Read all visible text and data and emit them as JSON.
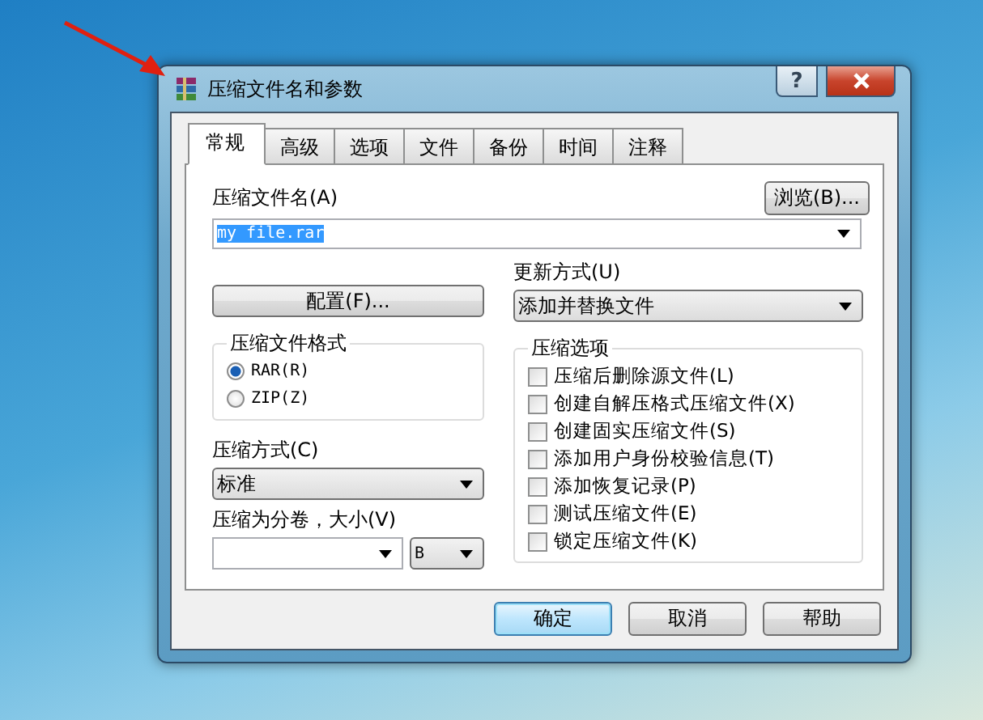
{
  "window": {
    "title": "压缩文件名和参数",
    "help": "?"
  },
  "tabs": [
    {
      "label": "常规",
      "selected": true
    },
    {
      "label": "高级",
      "selected": false
    },
    {
      "label": "选项",
      "selected": false
    },
    {
      "label": "文件",
      "selected": false
    },
    {
      "label": "备份",
      "selected": false
    },
    {
      "label": "时间",
      "selected": false
    },
    {
      "label": "注释",
      "selected": false
    }
  ],
  "archive_name": {
    "label": "压缩文件名(A)",
    "browse": "浏览(B)...",
    "value": "my file.rar",
    "highlighted": true
  },
  "profiles_button": "配置(F)...",
  "update_mode": {
    "label": "更新方式(U)",
    "value": "添加并替换文件"
  },
  "archive_format": {
    "title": "压缩文件格式",
    "options": [
      {
        "label": "RAR(R)",
        "selected": true
      },
      {
        "label": "ZIP(Z)",
        "selected": false
      }
    ]
  },
  "compression_method": {
    "label": "压缩方式(C)",
    "value": "标准"
  },
  "volumes": {
    "label": "压缩为分卷，大小(V)",
    "unit": "B"
  },
  "options": {
    "title": "压缩选项",
    "items": [
      {
        "label": "压缩后删除源文件(L)",
        "checked": false
      },
      {
        "label": "创建自解压格式压缩文件(X)",
        "checked": false
      },
      {
        "label": "创建固实压缩文件(S)",
        "checked": false
      },
      {
        "label": "添加用户身份校验信息(T)",
        "checked": false
      },
      {
        "label": "添加恢复记录(P)",
        "checked": false
      },
      {
        "label": "测试压缩文件(E)",
        "checked": false
      },
      {
        "label": "锁定压缩文件(K)",
        "checked": false
      }
    ]
  },
  "buttons": [
    {
      "label": "确定",
      "default": true
    },
    {
      "label": "取消",
      "default": false
    },
    {
      "label": "帮助",
      "default": false
    }
  ]
}
